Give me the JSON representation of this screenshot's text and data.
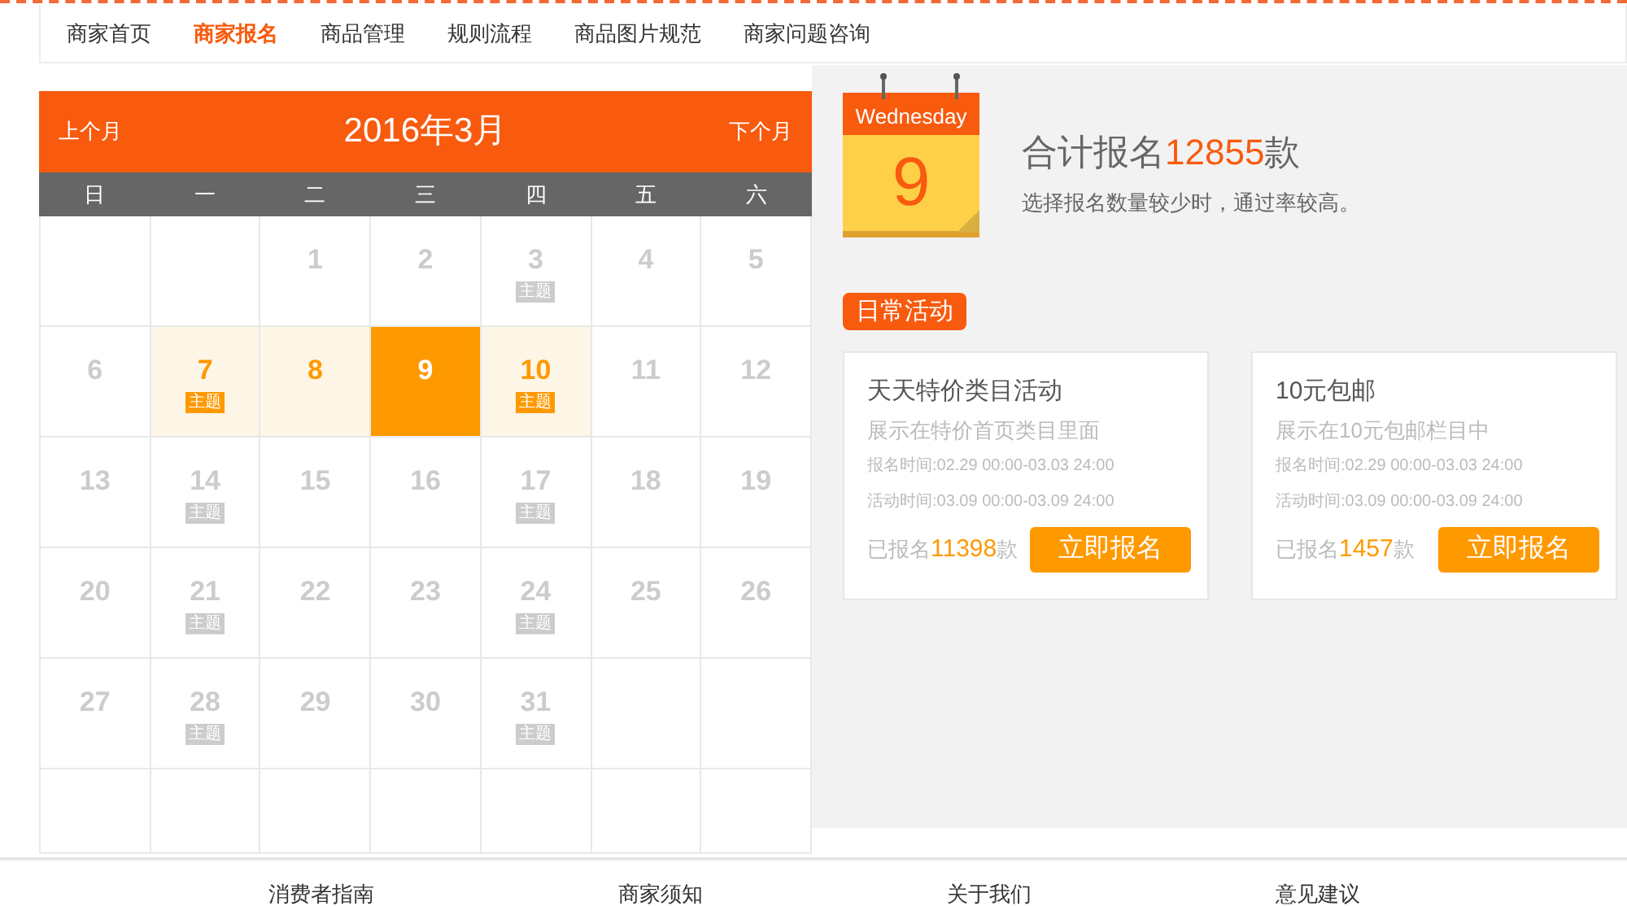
{
  "nav": [
    {
      "label": "商家首页",
      "selected": false
    },
    {
      "label": "商家报名",
      "selected": true
    },
    {
      "label": "商品管理",
      "selected": false
    },
    {
      "label": "规则流程",
      "selected": false
    },
    {
      "label": "商品图片规范",
      "selected": false
    },
    {
      "label": "商家问题咨询",
      "selected": false
    }
  ],
  "calendar": {
    "prev": "上个月",
    "title": "2016年3月",
    "next": "下个月",
    "weekdays": [
      "日",
      "一",
      "二",
      "三",
      "四",
      "五",
      "六"
    ],
    "cells": [
      {
        "kind": "blank"
      },
      {
        "kind": "blank"
      },
      {
        "kind": "day",
        "day": "1",
        "selected": false,
        "highlighted": false
      },
      {
        "kind": "day",
        "day": "2",
        "selected": false,
        "highlighted": false
      },
      {
        "kind": "day",
        "day": "3",
        "selected": false,
        "highlighted": false,
        "tag": "主题"
      },
      {
        "kind": "day",
        "day": "4",
        "selected": false,
        "highlighted": false
      },
      {
        "kind": "day",
        "day": "5",
        "selected": false,
        "highlighted": false
      },
      {
        "kind": "day",
        "day": "6",
        "selected": false,
        "highlighted": false
      },
      {
        "kind": "day",
        "day": "7",
        "selected": false,
        "highlighted": true,
        "tag": "主题"
      },
      {
        "kind": "day",
        "day": "8",
        "selected": false,
        "highlighted": true
      },
      {
        "kind": "day",
        "day": "9",
        "selected": true,
        "highlighted": false
      },
      {
        "kind": "day",
        "day": "10",
        "selected": false,
        "highlighted": true,
        "tag": "主题"
      },
      {
        "kind": "day",
        "day": "11",
        "selected": false,
        "highlighted": false
      },
      {
        "kind": "day",
        "day": "12",
        "selected": false,
        "highlighted": false
      },
      {
        "kind": "day",
        "day": "13",
        "selected": false,
        "highlighted": false
      },
      {
        "kind": "day",
        "day": "14",
        "selected": false,
        "highlighted": false,
        "tag": "主题"
      },
      {
        "kind": "day",
        "day": "15",
        "selected": false,
        "highlighted": false
      },
      {
        "kind": "day",
        "day": "16",
        "selected": false,
        "highlighted": false
      },
      {
        "kind": "day",
        "day": "17",
        "selected": false,
        "highlighted": false,
        "tag": "主题"
      },
      {
        "kind": "day",
        "day": "18",
        "selected": false,
        "highlighted": false
      },
      {
        "kind": "day",
        "day": "19",
        "selected": false,
        "highlighted": false
      },
      {
        "kind": "day",
        "day": "20",
        "selected": false,
        "highlighted": false
      },
      {
        "kind": "day",
        "day": "21",
        "selected": false,
        "highlighted": false,
        "tag": "主题"
      },
      {
        "kind": "day",
        "day": "22",
        "selected": false,
        "highlighted": false
      },
      {
        "kind": "day",
        "day": "23",
        "selected": false,
        "highlighted": false
      },
      {
        "kind": "day",
        "day": "24",
        "selected": false,
        "highlighted": false,
        "tag": "主题"
      },
      {
        "kind": "day",
        "day": "25",
        "selected": false,
        "highlighted": false
      },
      {
        "kind": "day",
        "day": "26",
        "selected": false,
        "highlighted": false
      },
      {
        "kind": "day",
        "day": "27",
        "selected": false,
        "highlighted": false
      },
      {
        "kind": "day",
        "day": "28",
        "selected": false,
        "highlighted": false,
        "tag": "主题"
      },
      {
        "kind": "day",
        "day": "29",
        "selected": false,
        "highlighted": false
      },
      {
        "kind": "day",
        "day": "30",
        "selected": false,
        "highlighted": false
      },
      {
        "kind": "day",
        "day": "31",
        "selected": false,
        "highlighted": false,
        "tag": "主题"
      },
      {
        "kind": "blank"
      },
      {
        "kind": "blank"
      },
      {
        "kind": "blank"
      },
      {
        "kind": "blank"
      },
      {
        "kind": "blank"
      },
      {
        "kind": "blank"
      },
      {
        "kind": "blank"
      },
      {
        "kind": "blank"
      },
      {
        "kind": "blank"
      }
    ]
  },
  "today_card": {
    "weekday": "Wednesday",
    "day": "9"
  },
  "summary": {
    "prefix": "合计报名",
    "count": "12855",
    "suffix": "款",
    "hint": "选择报名数量较少时，通过率较高。"
  },
  "section_tag": "日常活动",
  "activities": [
    {
      "title": "天天特价类目活动",
      "description": "展示在特价首页类目里面",
      "signup_time": "报名时间:02.29 00:00-03.03 24:00",
      "event_time": "活动时间:03.09 00:00-03.09 24:00",
      "count_prefix": "已报名",
      "count": "11398",
      "count_suffix": "款",
      "button": "立即报名"
    },
    {
      "title": "10元包邮",
      "description": "展示在10元包邮栏目中",
      "signup_time": "报名时间:02.29 00:00-03.03 24:00",
      "event_time": "活动时间:03.09 00:00-03.09 24:00",
      "count_prefix": "已报名",
      "count": "1457",
      "count_suffix": "款",
      "button": "立即报名"
    }
  ],
  "footer_links": [
    "消费者指南",
    "商家须知",
    "关于我们",
    "意见建议"
  ]
}
